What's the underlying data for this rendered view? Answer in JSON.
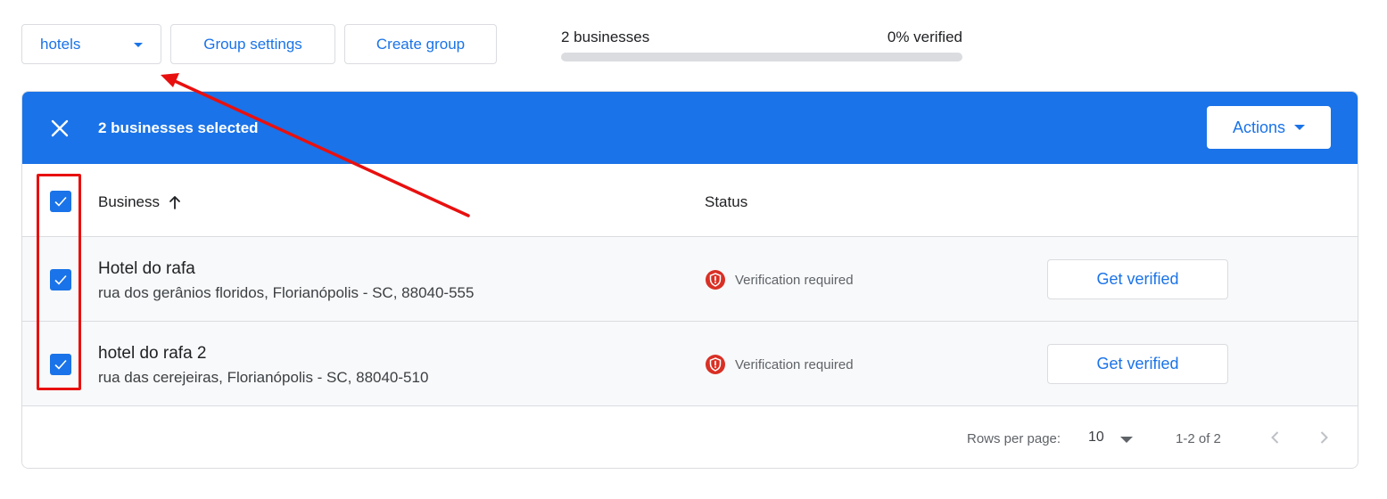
{
  "toolbar": {
    "group_select_value": "hotels",
    "group_settings_label": "Group settings",
    "create_group_label": "Create group"
  },
  "summary": {
    "business_count": "2 businesses",
    "verified_label": "0% verified",
    "verified_progress": 0
  },
  "selection_bar": {
    "selected_text": "2 businesses selected",
    "actions_label": "Actions"
  },
  "table": {
    "columns": {
      "business": "Business",
      "status": "Status"
    },
    "rows": [
      {
        "name": "Hotel do rafa",
        "address": "rua dos gerânios floridos, Florianópolis - SC, 88040-555",
        "status": "Verification required",
        "action": "Get verified",
        "checked": true
      },
      {
        "name": "hotel do rafa 2",
        "address": "rua das cerejeiras, Florianópolis - SC, 88040-510",
        "status": "Verification required",
        "action": "Get verified",
        "checked": true
      }
    ]
  },
  "pagination": {
    "rows_per_page_label": "Rows per page:",
    "rows_per_page_value": "10",
    "range_text": "1-2 of 2"
  },
  "icons": {
    "close": "close-icon",
    "checkbox": "checkbox-checked-icon",
    "sort": "arrow-up-icon",
    "status": "shield-alert-icon",
    "prev": "chevron-left-icon",
    "next": "chevron-right-icon"
  },
  "colors": {
    "primary": "#1a73e8",
    "error": "#d93025",
    "annotation": "#e8100f"
  }
}
